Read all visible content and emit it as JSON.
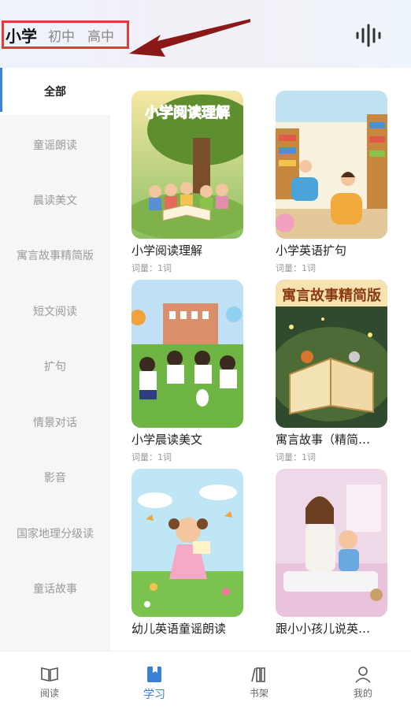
{
  "header": {
    "levels": [
      "小学",
      "初中",
      "高中"
    ],
    "active_level": "小学"
  },
  "sidebar": {
    "items": [
      {
        "label": "全部",
        "active": true
      },
      {
        "label": "童谣朗读"
      },
      {
        "label": "晨读美文"
      },
      {
        "label": "寓言故事精简版"
      },
      {
        "label": "短文阅读"
      },
      {
        "label": "扩句"
      },
      {
        "label": "情景对话"
      },
      {
        "label": "影音"
      },
      {
        "label": "国家地理分级读"
      },
      {
        "label": "童话故事"
      }
    ]
  },
  "cards": [
    {
      "title": "小学阅读理解",
      "meta": "词量：1词",
      "cover_text": "小学阅读理解"
    },
    {
      "title": "小学英语扩句",
      "meta": "词量：1词",
      "cover_text": ""
    },
    {
      "title": "小学晨读美文",
      "meta": "词量：1词",
      "cover_text": ""
    },
    {
      "title": "寓言故事（精简…",
      "meta": "词量：1词",
      "cover_text": "寓言故事精简版"
    },
    {
      "title": "幼儿英语童谣朗读",
      "meta": "",
      "cover_text": ""
    },
    {
      "title": "跟小小孩儿说英…",
      "meta": "",
      "cover_text": ""
    }
  ],
  "bottom_nav": [
    {
      "label": "阅读",
      "icon": "book-open-icon"
    },
    {
      "label": "学习",
      "icon": "bookmark-book-icon",
      "active": true
    },
    {
      "label": "书架",
      "icon": "bookshelf-icon"
    },
    {
      "label": "我的",
      "icon": "user-icon"
    }
  ],
  "colors": {
    "accent": "#3b82d6",
    "highlight_box": "#e23b3b"
  }
}
